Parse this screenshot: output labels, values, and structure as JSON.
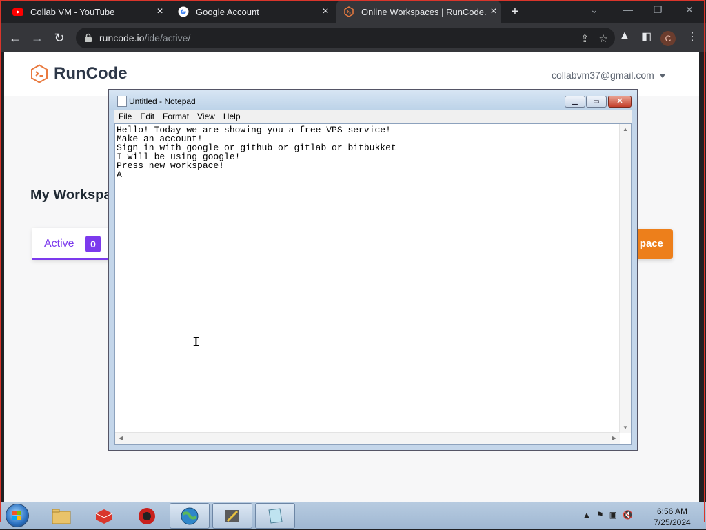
{
  "browser": {
    "tabs": [
      {
        "title": "Collab VM - YouTube",
        "icon": "youtube-icon"
      },
      {
        "title": "Google Account",
        "icon": "google-icon"
      },
      {
        "title": "Online Workspaces | RunCode.io",
        "icon": "runcode-icon",
        "active": true
      }
    ],
    "url_host": "runcode.io",
    "url_path": "/ide/active/",
    "profile_initial": "C"
  },
  "page": {
    "brand": "RunCode",
    "account_email": "collabvm37@gmail.com",
    "title": "My Workspa",
    "active_tab_label": "Active",
    "active_count": "0",
    "new_workspace_button": "pace"
  },
  "notepad": {
    "title": "Untitled - Notepad",
    "menu": [
      "File",
      "Edit",
      "Format",
      "View",
      "Help"
    ],
    "content": "Hello! Today we are showing you a free VPS service!\nMake an account!\nSign in with google or github or gitlab or bitbukket\nI will be using google!\nPress new workspace!\nA"
  },
  "taskbar": {
    "time": "6:56 AM",
    "date": "7/25/2024"
  },
  "colors": {
    "accent_purple": "#7c3aed",
    "accent_orange": "#ed7f1b",
    "chrome_dark": "#202124"
  }
}
